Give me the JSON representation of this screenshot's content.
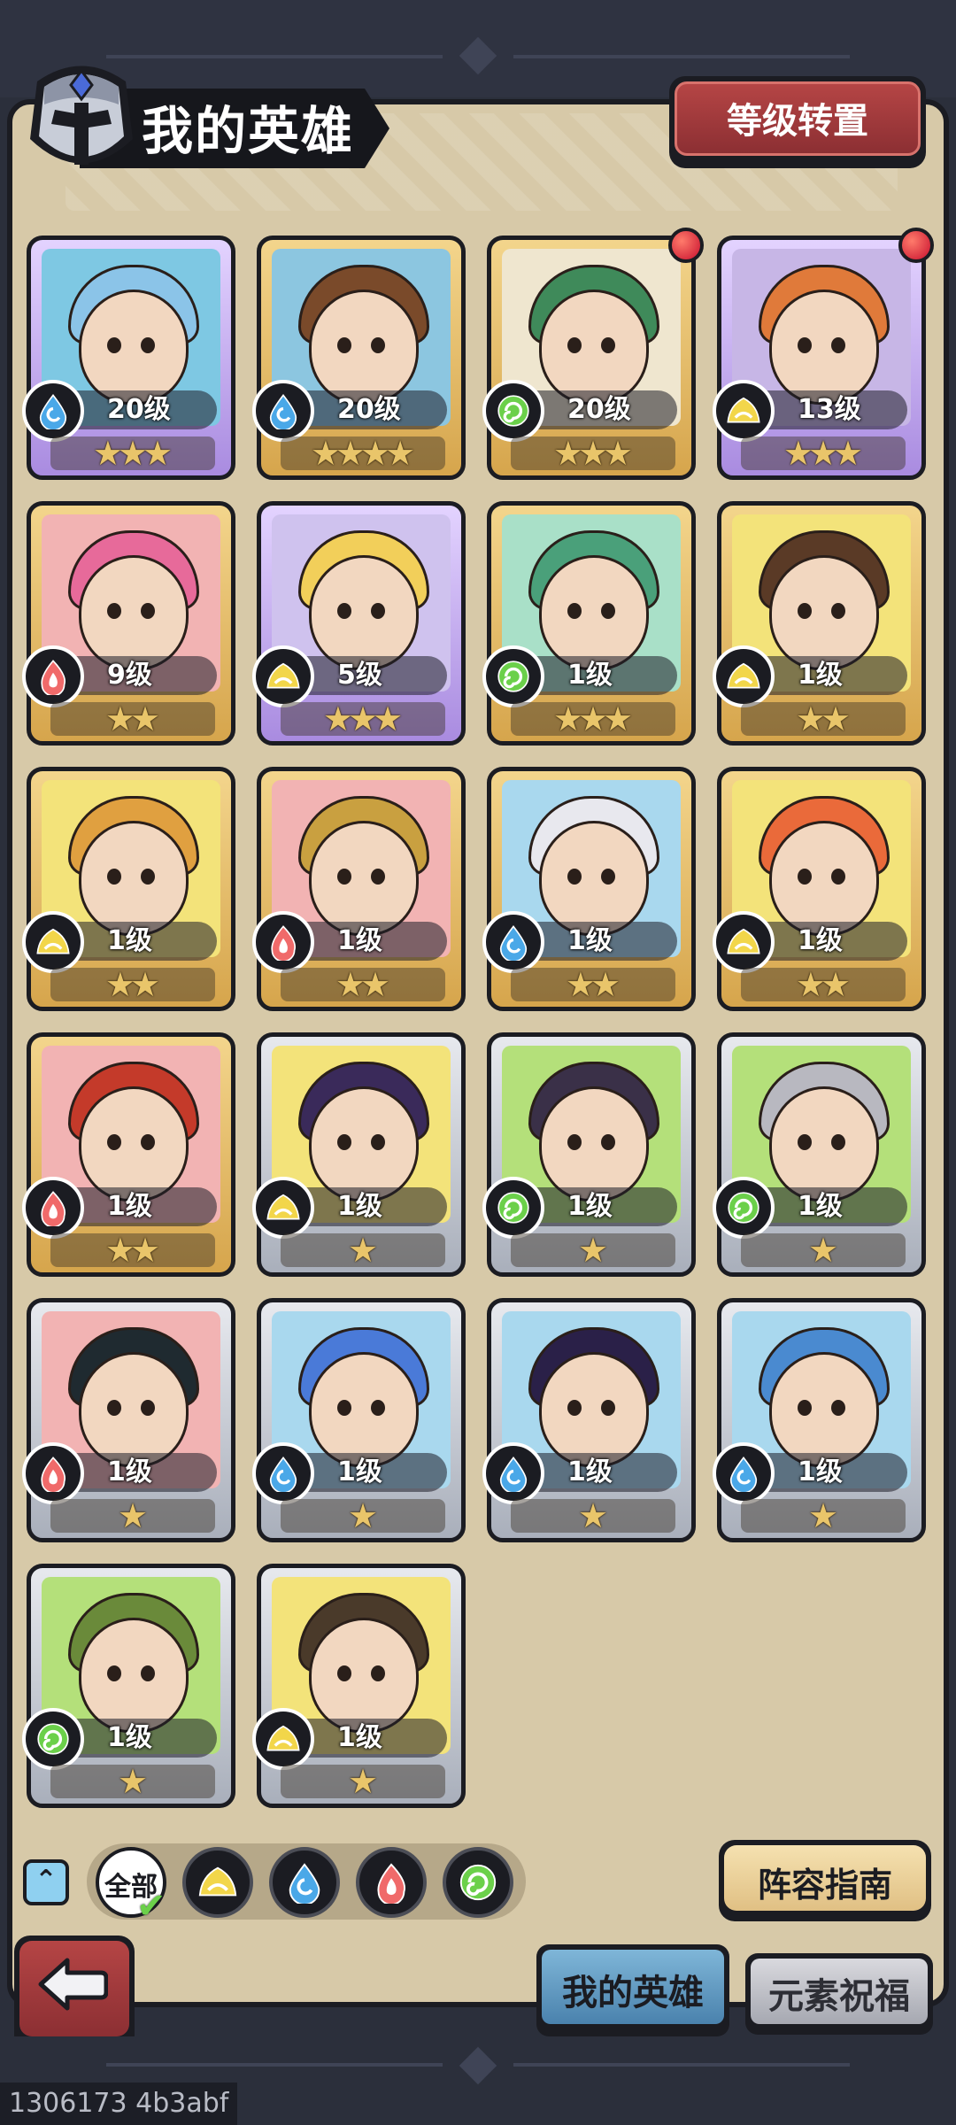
{
  "header": {
    "title": "我的英雄",
    "level_transfer_label": "等级转置"
  },
  "heroes": [
    {
      "level": "20级",
      "stars": 3,
      "element": "water",
      "frame": "purple",
      "alert": false,
      "hair": "#8bc4e8",
      "bg": "#7ec8e3"
    },
    {
      "level": "20级",
      "stars": 4,
      "element": "water",
      "frame": "gold",
      "alert": false,
      "hair": "#7a4a2a",
      "bg": "#8cc6e0"
    },
    {
      "level": "20级",
      "stars": 3,
      "element": "wind",
      "frame": "gold",
      "alert": true,
      "hair": "#3f8a5a",
      "bg": "#efe6cf"
    },
    {
      "level": "13级",
      "stars": 3,
      "element": "earth",
      "frame": "purple",
      "alert": true,
      "hair": "#e07a3a",
      "bg": "#c7b6e6"
    },
    {
      "level": "9级",
      "stars": 2,
      "element": "fire",
      "frame": "gold",
      "alert": false,
      "hair": "#e76a9a",
      "bg": "#f2b3b3"
    },
    {
      "level": "5级",
      "stars": 3,
      "element": "earth",
      "frame": "purple",
      "alert": false,
      "hair": "#f2cf5a",
      "bg": "#cfc2ee"
    },
    {
      "level": "1级",
      "stars": 3,
      "element": "wind",
      "frame": "gold",
      "alert": false,
      "hair": "#4aa07a",
      "bg": "#a9e0c8"
    },
    {
      "level": "1级",
      "stars": 2,
      "element": "earth",
      "frame": "gold",
      "alert": false,
      "hair": "#5a3a26",
      "bg": "#f3e37a"
    },
    {
      "level": "1级",
      "stars": 2,
      "element": "earth",
      "frame": "gold",
      "alert": false,
      "hair": "#e0a040",
      "bg": "#f3e37a"
    },
    {
      "level": "1级",
      "stars": 2,
      "element": "fire",
      "frame": "gold",
      "alert": false,
      "hair": "#c9a040",
      "bg": "#f2b3b3"
    },
    {
      "level": "1级",
      "stars": 2,
      "element": "water",
      "frame": "gold",
      "alert": false,
      "hair": "#e8e8ee",
      "bg": "#a9d8ee"
    },
    {
      "level": "1级",
      "stars": 2,
      "element": "earth",
      "frame": "gold",
      "alert": false,
      "hair": "#ea6a3a",
      "bg": "#f3e37a"
    },
    {
      "level": "1级",
      "stars": 2,
      "element": "fire",
      "frame": "gold",
      "alert": false,
      "hair": "#c43a2a",
      "bg": "#f2b3b3"
    },
    {
      "level": "1级",
      "stars": 1,
      "element": "earth",
      "frame": "silver",
      "alert": false,
      "hair": "#3a2a5a",
      "bg": "#f3e37a"
    },
    {
      "level": "1级",
      "stars": 1,
      "element": "wind",
      "frame": "silver",
      "alert": false,
      "hair": "#3a3048",
      "bg": "#b4e07a"
    },
    {
      "level": "1级",
      "stars": 1,
      "element": "wind",
      "frame": "silver",
      "alert": false,
      "hair": "#b8b8c0",
      "bg": "#b4e07a"
    },
    {
      "level": "1级",
      "stars": 1,
      "element": "fire",
      "frame": "silver",
      "alert": false,
      "hair": "#1f2a30",
      "bg": "#f2b3b3"
    },
    {
      "level": "1级",
      "stars": 1,
      "element": "water",
      "frame": "silver",
      "alert": false,
      "hair": "#4a7ad8",
      "bg": "#a9d8ee"
    },
    {
      "level": "1级",
      "stars": 1,
      "element": "water",
      "frame": "silver",
      "alert": false,
      "hair": "#2a2048",
      "bg": "#a9d8ee"
    },
    {
      "level": "1级",
      "stars": 1,
      "element": "water",
      "frame": "silver",
      "alert": false,
      "hair": "#4a8ad0",
      "bg": "#a9d8ee"
    },
    {
      "level": "1级",
      "stars": 1,
      "element": "wind",
      "frame": "silver",
      "alert": false,
      "hair": "#6a8a3a",
      "bg": "#b4e07a"
    },
    {
      "level": "1级",
      "stars": 1,
      "element": "earth",
      "frame": "silver",
      "alert": false,
      "hair": "#4a3a2a",
      "bg": "#f3e37a"
    }
  ],
  "filters": {
    "all_label": "全部",
    "elements": [
      "earth",
      "water",
      "fire",
      "wind"
    ]
  },
  "lineup_guide_label": "阵容指南",
  "tabs": {
    "my_heroes": "我的英雄",
    "element_blessing": "元素祝福"
  },
  "build_id": "1306173 4b3abf",
  "colors": {
    "water": "#4aa8e8",
    "fire": "#f06a6a",
    "earth": "#f2d64a",
    "wind": "#6bd04a"
  },
  "icons": {
    "back": "back-arrow-icon",
    "collapse": "chevron-up-icon",
    "helmet": "helmet-icon",
    "alert": "red-dot-icon",
    "star": "star-icon"
  }
}
